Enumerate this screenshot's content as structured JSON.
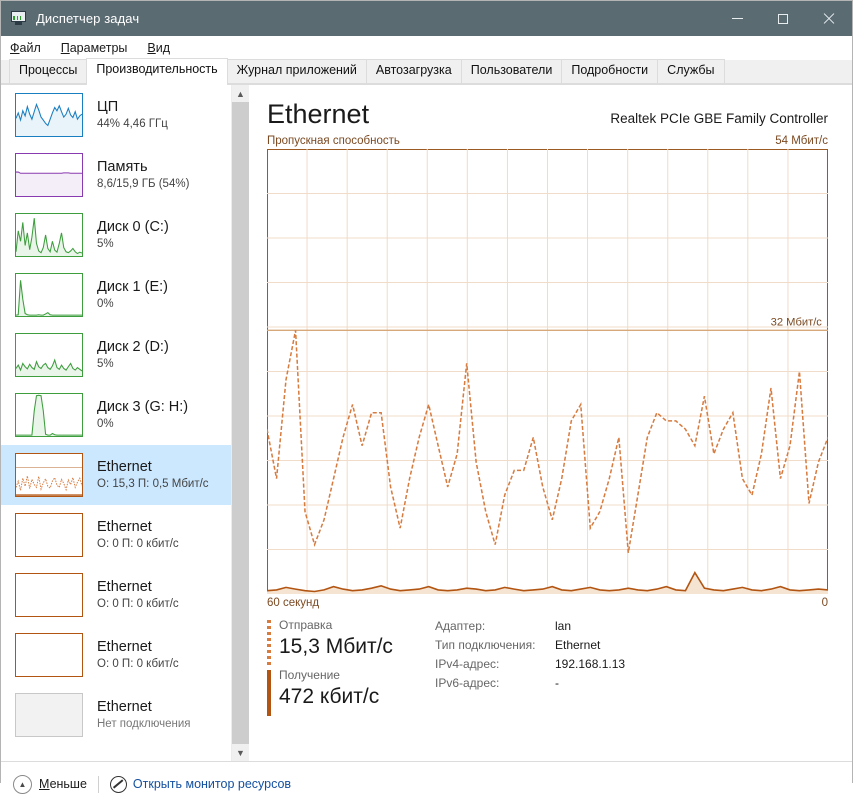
{
  "window": {
    "title": "Диспетчер задач",
    "icon": "task-manager-icon",
    "minimize": "—",
    "maximize": "□",
    "close": "✕"
  },
  "menu": [
    {
      "label": "Файл",
      "accel": "Ф"
    },
    {
      "label": "Параметры",
      "accel": "П"
    },
    {
      "label": "Вид",
      "accel": "В"
    }
  ],
  "tabs": [
    {
      "label": "Процессы",
      "active": false
    },
    {
      "label": "Производительность",
      "active": true
    },
    {
      "label": "Журнал приложений",
      "active": false
    },
    {
      "label": "Автозагрузка",
      "active": false
    },
    {
      "label": "Пользователи",
      "active": false
    },
    {
      "label": "Подробности",
      "active": false
    },
    {
      "label": "Службы",
      "active": false
    }
  ],
  "sidebar": {
    "items": [
      {
        "name": "ЦП",
        "sub": "44%  4,46 ГГц",
        "color": "#1a7fc1",
        "fill": "#e9f3fa",
        "selected": false,
        "kind": "cpu"
      },
      {
        "name": "Память",
        "sub": "8,6/15,9 ГБ (54%)",
        "color": "#8a3ab0",
        "fill": "#f3eef7",
        "selected": false,
        "kind": "memory"
      },
      {
        "name": "Диск 0 (C:)",
        "sub": "5%",
        "color": "#3e9e3e",
        "fill": "#eaf5ea",
        "selected": false,
        "kind": "disk0"
      },
      {
        "name": "Диск 1 (E:)",
        "sub": "0%",
        "color": "#3e9e3e",
        "fill": "#eaf5ea",
        "selected": false,
        "kind": "disk1"
      },
      {
        "name": "Диск 2 (D:)",
        "sub": "5%",
        "color": "#3e9e3e",
        "fill": "#eaf5ea",
        "selected": false,
        "kind": "disk2"
      },
      {
        "name": "Диск 3 (G: H:)",
        "sub": "0%",
        "color": "#3e9e3e",
        "fill": "#eaf5ea",
        "selected": false,
        "kind": "disk3"
      },
      {
        "name": "Ethernet",
        "sub": "О: 15,3 П: 0,5 Мбит/с",
        "color": "#b25512",
        "fill": "#ffffff",
        "selected": true,
        "kind": "eth-active"
      },
      {
        "name": "Ethernet",
        "sub": "О: 0 П: 0 кбит/с",
        "color": "#b25512",
        "fill": "#ffffff",
        "selected": false,
        "kind": "eth-idle"
      },
      {
        "name": "Ethernet",
        "sub": "О: 0 П: 0 кбит/с",
        "color": "#b25512",
        "fill": "#ffffff",
        "selected": false,
        "kind": "eth-idle"
      },
      {
        "name": "Ethernet",
        "sub": "О: 0 П: 0 кбит/с",
        "color": "#b25512",
        "fill": "#ffffff",
        "selected": false,
        "kind": "eth-idle"
      },
      {
        "name": "Ethernet",
        "sub": "Нет подключения",
        "color": "#c8c8c8",
        "fill": "#f2f2f2",
        "selected": false,
        "kind": "eth-off"
      }
    ],
    "scroll_up_icon": "chevron-up-icon",
    "scroll_down_icon": "chevron-down-icon"
  },
  "main": {
    "title": "Ethernet",
    "adapter_title": "Realtek PCIe GBE Family Controller",
    "chart_caption_left": "Пропускная способность",
    "chart_caption_right": "54 Мбит/с",
    "reference_label": "32 Мбит/с",
    "axis_left": "60 секунд",
    "axis_right": "0",
    "send": {
      "label": "Отправка",
      "value": "15,3 Мбит/с"
    },
    "receive": {
      "label": "Получение",
      "value": "472 кбит/с"
    },
    "info": [
      {
        "key": "Адаптер:",
        "value": "lan"
      },
      {
        "key": "Тип подключения:",
        "value": "Ethernet"
      },
      {
        "key": "IPv4-адрес:",
        "value": "192.168.1.13"
      },
      {
        "key": "IPv6-адрес:",
        "value": "-"
      }
    ]
  },
  "footer": {
    "less_label": "Меньше",
    "less_icon": "chevron-up-circle-icon",
    "resource_monitor_label": "Открыть монитор ресурсов",
    "resource_monitor_icon": "resource-monitor-icon"
  },
  "chart_data": {
    "type": "line",
    "title": "Ethernet — Пропускная способность",
    "xlabel": "60 секунд",
    "ylabel": "Мбит/с",
    "ylim": [
      0,
      54
    ],
    "reference_line": 32,
    "grid": true,
    "x_axis_labels": [
      "60 секунд",
      "0"
    ],
    "series": [
      {
        "name": "Отправка",
        "color": "#d77b3f",
        "style": "dashed",
        "unit": "Мбит/с",
        "values": [
          20,
          14,
          26,
          32,
          10,
          6,
          9,
          14,
          19,
          23,
          18,
          22,
          22,
          13,
          8,
          14,
          19,
          23,
          18,
          13,
          17,
          28,
          16,
          10,
          6,
          12,
          15,
          15,
          19,
          13,
          9,
          14,
          21,
          23,
          8,
          10,
          14,
          19,
          5,
          12,
          19,
          22,
          21,
          21,
          20,
          18,
          24,
          17,
          20,
          22,
          14,
          12,
          17,
          25,
          14,
          18,
          27,
          11,
          16,
          19
        ]
      },
      {
        "name": "Получение",
        "color": "#b25512",
        "style": "solid-area",
        "unit": "Мбит/с",
        "values": [
          0.4,
          0.5,
          0.8,
          0.6,
          0.4,
          0.3,
          0.5,
          0.9,
          0.6,
          0.4,
          0.5,
          0.7,
          1.0,
          0.6,
          0.4,
          0.5,
          0.6,
          0.9,
          0.5,
          0.4,
          0.5,
          0.7,
          0.6,
          0.4,
          0.5,
          0.8,
          0.6,
          0.4,
          0.5,
          0.6,
          0.9,
          0.5,
          0.4,
          0.6,
          0.8,
          0.5,
          0.4,
          0.5,
          0.7,
          0.5,
          0.4,
          0.6,
          0.9,
          0.5,
          0.4,
          2.6,
          0.7,
          0.5,
          0.4,
          0.6,
          0.8,
          0.5,
          0.4,
          0.6,
          0.9,
          0.5,
          0.4,
          0.5,
          0.6,
          0.5
        ]
      }
    ]
  }
}
